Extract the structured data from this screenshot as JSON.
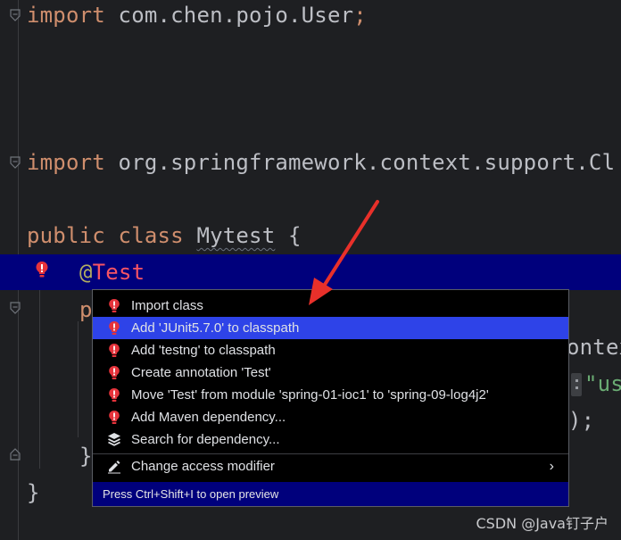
{
  "editor": {
    "line1": {
      "keyword": "import",
      "rest": " com.chen.pojo.User",
      "semi": ";"
    },
    "line2": {
      "keyword": "import",
      "rest": " org.springframework.context.support.Cl"
    },
    "line3": {
      "kw1": "public",
      "kw2": " class ",
      "name": "Mytest",
      "rest": " {"
    },
    "line4": {
      "at": "@",
      "annotation": "Test"
    },
    "line5": {
      "text": "p"
    },
    "frag_context": "ontex",
    "frag_string": "\"us",
    "frag_close": ");",
    "line_close_inner": "}",
    "line_close_outer": "}"
  },
  "popup": {
    "items": [
      {
        "label": "Import class",
        "icon": "bulb-red-icon"
      },
      {
        "label": "Add 'JUnit5.7.0' to classpath",
        "icon": "bulb-red-icon",
        "selected": true
      },
      {
        "label": "Add 'testng' to classpath",
        "icon": "bulb-red-icon"
      },
      {
        "label": "Create annotation 'Test'",
        "icon": "bulb-red-icon"
      },
      {
        "label": "Move 'Test' from module 'spring-01-ioc1' to 'spring-09-log4j2'",
        "icon": "bulb-red-icon"
      },
      {
        "label": "Add Maven dependency...",
        "icon": "bulb-red-icon"
      },
      {
        "label": "Search for dependency...",
        "icon": "layers-icon"
      },
      {
        "label": "Change access modifier",
        "icon": "pencil-icon",
        "submenu": "›"
      }
    ],
    "footer": "Press Ctrl+Shift+I to open preview"
  },
  "watermark": "CSDN @Java钉子户",
  "colors": {
    "background": "#1e1f22",
    "highlight_row": "#00007c",
    "selected_item": "#2e43e8",
    "keyword": "#cf8e6d",
    "error_red": "#f75464",
    "arrow": "#e8302a"
  }
}
